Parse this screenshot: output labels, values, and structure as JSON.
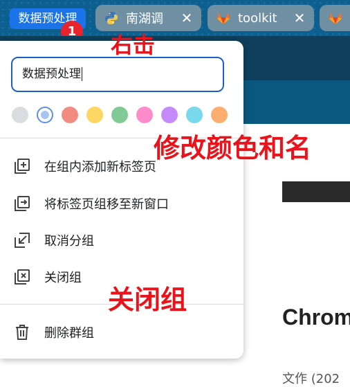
{
  "tab_group": {
    "name": "数据预处理",
    "color": "#1a73e8"
  },
  "badge": "1",
  "tabs": [
    {
      "title": "南湖调",
      "icon": "python-icon"
    },
    {
      "title": "toolkit",
      "icon": "gitlab-icon"
    },
    {
      "title": "",
      "icon": "gitlab-icon"
    }
  ],
  "tab_close_glyph": "✕",
  "annotations": {
    "right_click": "右击",
    "modify_color_name": "修改颜色和名",
    "close_group": "关闭组"
  },
  "menu": {
    "name_field_value": "数据预处理",
    "colors": [
      {
        "name": "grey",
        "hex": "#dadce0"
      },
      {
        "name": "blue",
        "hex": "#8ab4f8",
        "selected": true
      },
      {
        "name": "red",
        "hex": "#f28b82"
      },
      {
        "name": "yellow",
        "hex": "#fdd663"
      },
      {
        "name": "green",
        "hex": "#81c995"
      },
      {
        "name": "pink",
        "hex": "#ff8bcb"
      },
      {
        "name": "purple",
        "hex": "#c58af9"
      },
      {
        "name": "cyan",
        "hex": "#78d9ec"
      },
      {
        "name": "orange",
        "hex": "#fcad70"
      }
    ],
    "items": [
      {
        "label": "在组内添加新标签页",
        "icon": "add-tab-icon"
      },
      {
        "label": "将标签页组移至新窗口",
        "icon": "move-to-window-icon"
      },
      {
        "label": "取消分组",
        "icon": "ungroup-icon"
      },
      {
        "label": "关闭组",
        "icon": "close-group-icon"
      },
      {
        "label": "删除群组",
        "icon": "trash-icon"
      }
    ]
  },
  "page": {
    "heading": "Chrom",
    "subtext": "文作 (202"
  }
}
